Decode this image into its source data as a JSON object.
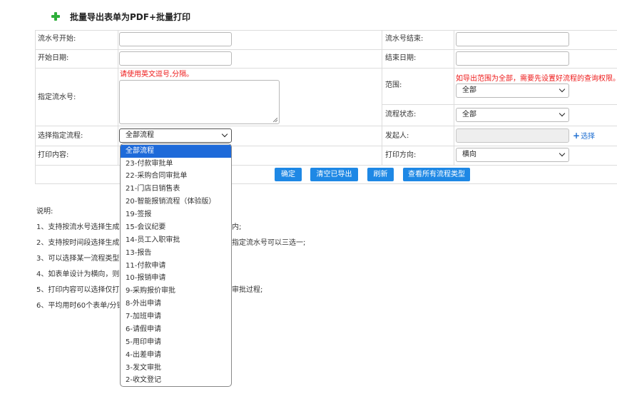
{
  "title": "批量导出表单为PDF+批量打印",
  "labels": {
    "serial_start": "流水号开始:",
    "serial_end": "流水号结束:",
    "start_date": "开始日期:",
    "end_date": "结束日期:",
    "specified_serials": "指定流水号:",
    "scope": "范围:",
    "flow_status": "流程状态:",
    "select_flow": "选择指定流程:",
    "initiator": "发起人:",
    "print_content": "打印内容:",
    "print_direction": "打印方向:"
  },
  "hints": {
    "serials": "请使用英文逗号,分隔。",
    "scope": "如导出范围为全部，需要先设置好流程的查询权限。"
  },
  "selects": {
    "scope": "全部",
    "flow_status": "全部",
    "flow": "全部流程",
    "print_direction": "横向"
  },
  "select_link": "选择",
  "select_link_icon": "plus-icon",
  "buttons": {
    "confirm": "确定",
    "clear_exported": "清空已导出",
    "refresh": "刷新",
    "view_all_types": "查看所有流程类型"
  },
  "notes": {
    "heading": "说明:",
    "lines": [
      "1、支持按流水号选择生成",
      "2、支持按时间段选择生成",
      "3、可以选择某一流程类型",
      "4、如表单设计为横向，则",
      "5、打印内容可以选择仅打",
      "6、平均用时60个表单/分钟"
    ],
    "tails": [
      "内;",
      "指定流水号可以三选一;",
      "",
      "",
      "审批过程;",
      ""
    ]
  },
  "dropdown_options": [
    "全部流程",
    "23-付款审批单",
    "22-采购合同审批单",
    "21-门店日销售表",
    "20-智能报销流程（体验版）",
    "19-签报",
    "15-会议纪要",
    "14-员工入职审批",
    "13-报告",
    "11-付款申请",
    "10-报销申请",
    "9-采购报价审批",
    "8-外出申请",
    "7-加班申请",
    "6-请假申请",
    "5-用印申请",
    "4-出差申请",
    "3-发文审批",
    "2-收文登记"
  ],
  "colors": {
    "accent": "#1e88e5",
    "selected": "#1e6ad9",
    "warning": "#ee1a1a",
    "plus_icon": "#2eae3a"
  }
}
